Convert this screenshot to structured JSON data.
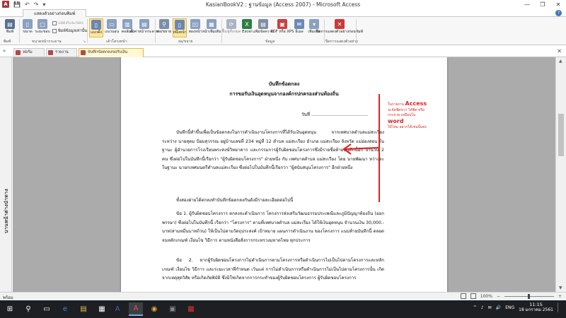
{
  "window": {
    "title": "KasianBookV2 : ฐานข้อมูล (Access 2007) - Microsoft Access",
    "app_icon_letter": "A",
    "controls": [
      "—",
      "❐",
      "✕"
    ]
  },
  "quick_access": [
    "💾",
    "↶",
    "↷",
    "▾"
  ],
  "ribbon": {
    "active_tab": "แสดงตัวอย่างก่อนพิมพ์",
    "help": "?",
    "buttons": {
      "print": "พิมพ์",
      "size": "ขนาด",
      "margins": "ระยะขอบ",
      "portrait": "แนวตั้ง",
      "landscape": "แนวนอน",
      "columns": "คอลัมน์",
      "page_setup": "ตั้งค่าหน้ากระดาษ",
      "zoom": "ย่อ/ขยาย",
      "one_page": "หนึ่งหน้า",
      "two_pages": "สองหน้า",
      "more_pages": "หน้าเพิ่มเติม",
      "refresh_all": "ฟื้นฟูทั้งหมด",
      "excel": "Excel",
      "text_file": "แฟ้มข้อความ",
      "pdf_xps": "PDF หรือ XPS",
      "email": "อีเมล",
      "more": "เพิ่มเติม",
      "close_preview": "ปิดการแสดงตัวอย่างก่อนพิมพ์"
    },
    "options": {
      "show_margins": "แสดงระยะขอบ",
      "print_data_only": "พิมพ์ข้อมูลเท่านั้น"
    },
    "groups": {
      "print": "พิมพ์",
      "page_size": "ขนาดหน้ากระดาษ",
      "page_layout": "เค้าโครงหน้า",
      "zoom": "ย่อ/ขยาย",
      "data": "ข้อมูล",
      "close_preview": "ปิดการแสดงตัวอย่าง"
    }
  },
  "doc_tabs": {
    "tabs": [
      "ฟอร์ม",
      "รายงาน",
      "บันทึกข้อตกลงขอรับเงิน"
    ],
    "close": "✕"
  },
  "nav_pane": {
    "label": "บานหน้าต่างนำทาง"
  },
  "document": {
    "title_line1": "บันทึกข้อตกลง",
    "title_line2": "การขอรับเงินอุดหนุนจากองค์กรปกครองส่วนท้องถิ่น",
    "date_line": "วันที่ ........................................",
    "paragraphs": [
      "บันทึกนี้ทำขึ้นเพื่อเป็นข้อตกลงในการดำเนินงานโครงการที่ได้รับเงินอุดหนุน จากเทศบาลตำบลแม่สะเรียง ระหว่าง นายสุดม ป้อมสุวรรณ อยู่บ้านเลขที่ 234 หมู่ที่ 12 ตำบล แม่สะเรียง อำเภอ แม่สะเรียง จังหวัด แม่ฮ่องสอน ในฐานะ ผู้อำนวยการโรงเรียนพระสงฆ์วิทยาคาร และกรรมการผู้รับผิดชอบโครงการซึ่งมีรายชื่อท้ายบันทึกนี้อีก จำนวน 2 คน ซึ่งต่อไปในบันทึกนี้เรียกว่า \"ผู้รับผิดชอบโครงการ\" ฝ่ายหนึ่ง กับ เทศบาลตำบล แม่สะเรียง โดย นายพัฒนา หว่างจะ ในฐานะ นายกเทศมนตรีตำบลแม่สะเรียง ซึ่งต่อไปในบันทึกนี้เรียกว่า \"ผู้สนับสนุนโครงการ\" อีกฝ่ายหนึ่ง",
      "ทั้งสองฝ่ายได้ตกลงทำบันทึกข้อตกลงกันดังมีรายละเอียดต่อไปนี้",
      "ข้อ 1. ผู้รับผิดชอบโครงการ ตกลงจะดำเนินการ โครงการส่งเสริมวัฒนธรรมประเพณีและภูมิปัญญาท้องถิ่น (ออกพรรษา) ซึ่งต่อไปในบันทึกนี้ เรียกว่า \"โครงการ\" ตามที่เทศบาลตำบล แม่สะเรียง ได้ให้เงินอุดหนุน จำนวนเงิน 30,000.-บาท(สามหมื่นบาทถ้วน) ให้เป็นไปตามวัตถุประสงค์ เป้าหมาย แผนการดำเนินงาน ของโครงการ แนบท้ายบันทึกนี้ ตลอดจนหลักเกณฑ์ เงื่อนไข วิธีการ ตามหนังสือสั่งการกระทรวงมหาดไทย ทุกประการ",
      "ข้อ 2. หากผู้รับผิดชอบโครงการไม่ดำเนินการตามโครงการหรือดำเนินการไม่เป็นไปตามโครงการและหลักเกณฑ์ เงื่อนไข วิธีการ และระยะเวลาที่กำหนด เว้นแต่ การไม่ดำเนินการหรือดำเนินการไม่เป็นไปตามโครงการนั้น เกิดจากเหตุสุดวิสัย หรือเกิดภัยพิบัติ ซึ่งมิใช่เกิดจากการกระทำของผู้รับผิดชอบโครงการ ผู้รับผิดชอบโครงการ"
    ]
  },
  "annotation": {
    "l1": "ในรายงาน",
    "big1": "Access",
    "l2": "จะจัดชิดขวา ได้ชิด หรือ",
    "l3": "กระจาย เหมือนใน",
    "big2": "word",
    "l4": "ได้ไหม อยากได้เช่นนั้นค่ะ",
    "color": "#e02020"
  },
  "status": {
    "ready": "พร้อม",
    "zoom": "100%"
  },
  "taskbar": {
    "start": "⊞",
    "search": "⚲",
    "apps": [
      "▭",
      "e",
      "▤",
      "▦",
      "A",
      "◉",
      "▣",
      "▩"
    ],
    "tray": [
      "^",
      "♪",
      "✉",
      "🔊"
    ],
    "lang": "ENG",
    "time": "11:15",
    "date": "18 มกราคม 2561"
  }
}
